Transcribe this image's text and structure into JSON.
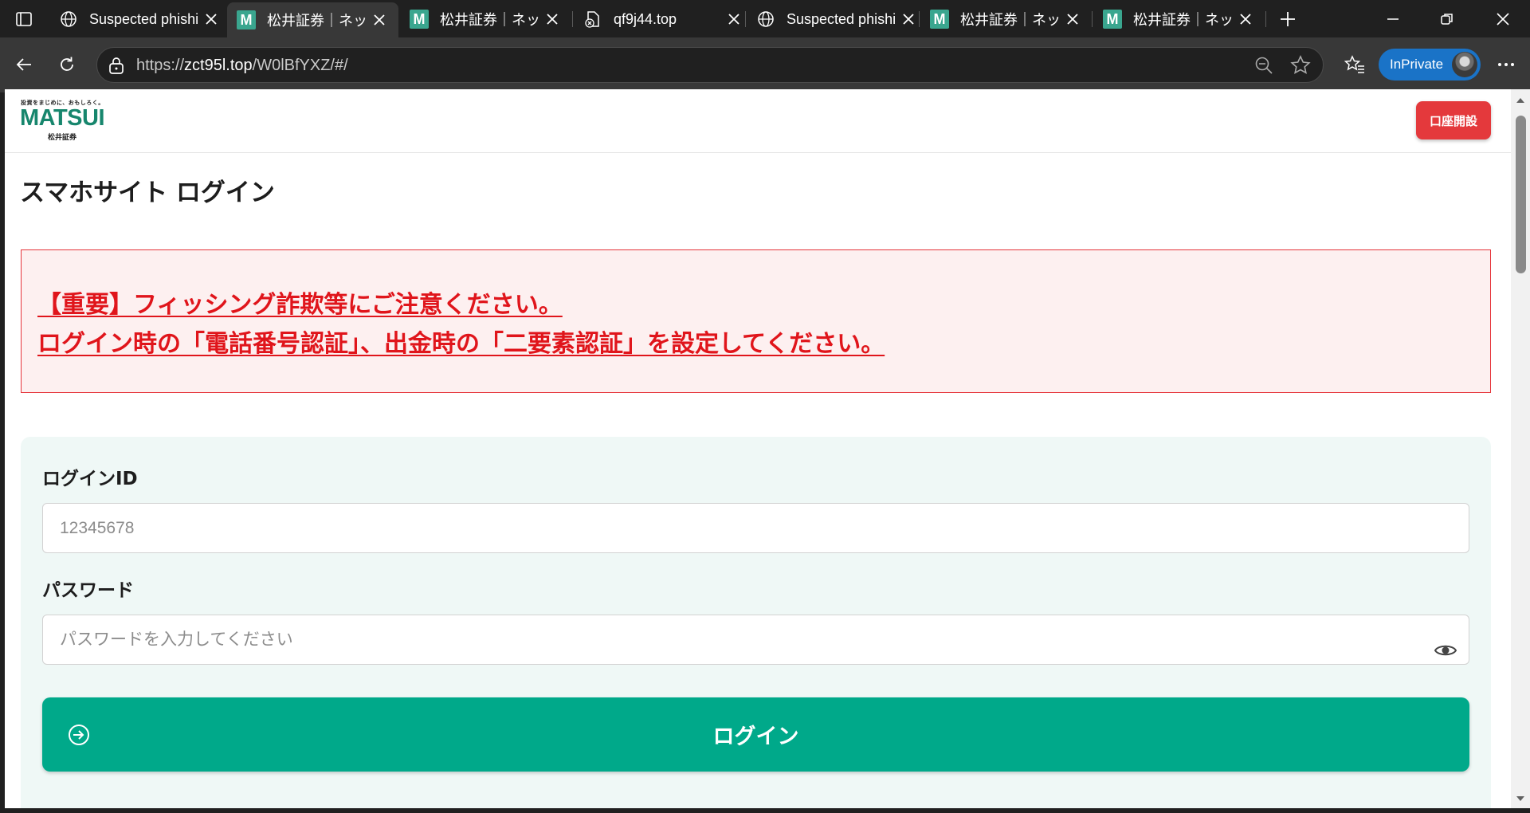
{
  "browser": {
    "tabs": [
      {
        "title": "Suspected phishing",
        "icon": "globe-icon"
      },
      {
        "title": "松井証券｜ネット証券",
        "icon": "matsui-favicon",
        "active": true
      },
      {
        "title": "松井証券｜ネット証券",
        "icon": "matsui-favicon"
      },
      {
        "title": "qf9j44.top",
        "icon": "error-page-icon"
      },
      {
        "title": "Suspected phishing",
        "icon": "globe-icon"
      },
      {
        "title": "松井証券｜ネット証券",
        "icon": "matsui-favicon"
      },
      {
        "title": "松井証券｜ネット証券",
        "icon": "matsui-favicon"
      }
    ],
    "favicon_letter": "M",
    "url_prefix": "https://",
    "url_host": "zct95l.top",
    "url_path": "/W0lBfYXZ/#/",
    "inprivate_label": "InPrivate",
    "accent_color": "#1a73c7"
  },
  "site": {
    "logo": {
      "tagline": "投資をまじめに、おもしろく。",
      "brand": "MATSUI",
      "brand_sub": "松井証券"
    },
    "open_account_label": "口座開設",
    "page_title": "スマホサイト ログイン",
    "alert": {
      "line1": "【重要】フィッシング詐欺等にご注意ください。",
      "line2": "ログイン時の「電話番号認証」、出金時の「二要素認証」を設定してください。"
    },
    "form": {
      "login_id_label": "ログインID",
      "login_id_placeholder": "12345678",
      "password_label": "パスワード",
      "password_placeholder": "パスワードを入力してください",
      "login_button_label": "ログイン"
    },
    "colors": {
      "brand_green": "#17866d",
      "button_green": "#00a98a",
      "alert_red": "#e0151b",
      "open_account_red": "#e4393c"
    }
  }
}
